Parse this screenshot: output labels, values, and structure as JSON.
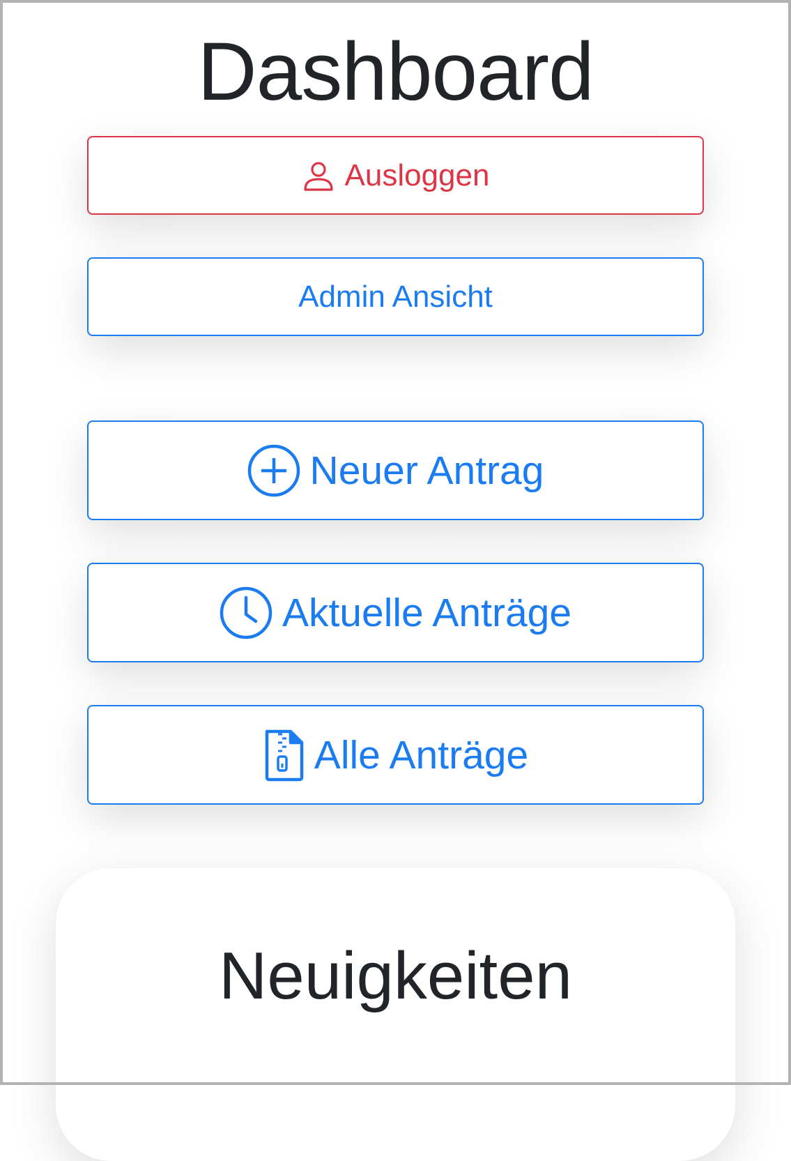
{
  "page": {
    "title": "Dashboard"
  },
  "buttons": {
    "logout": {
      "label": "Ausloggen",
      "icon": "person-icon"
    },
    "admin": {
      "label": "Admin Ansicht"
    },
    "new_request": {
      "label": "Neuer Antrag",
      "icon": "plus-circle-icon"
    },
    "current_requests": {
      "label": "Aktuelle Anträge",
      "icon": "clock-icon"
    },
    "all_requests": {
      "label": "Alle Anträge",
      "icon": "file-zip-icon"
    }
  },
  "news": {
    "title": "Neuigkeiten"
  },
  "colors": {
    "primary": "#1a7cf0",
    "danger": "#dc3545",
    "text": "#212529"
  }
}
